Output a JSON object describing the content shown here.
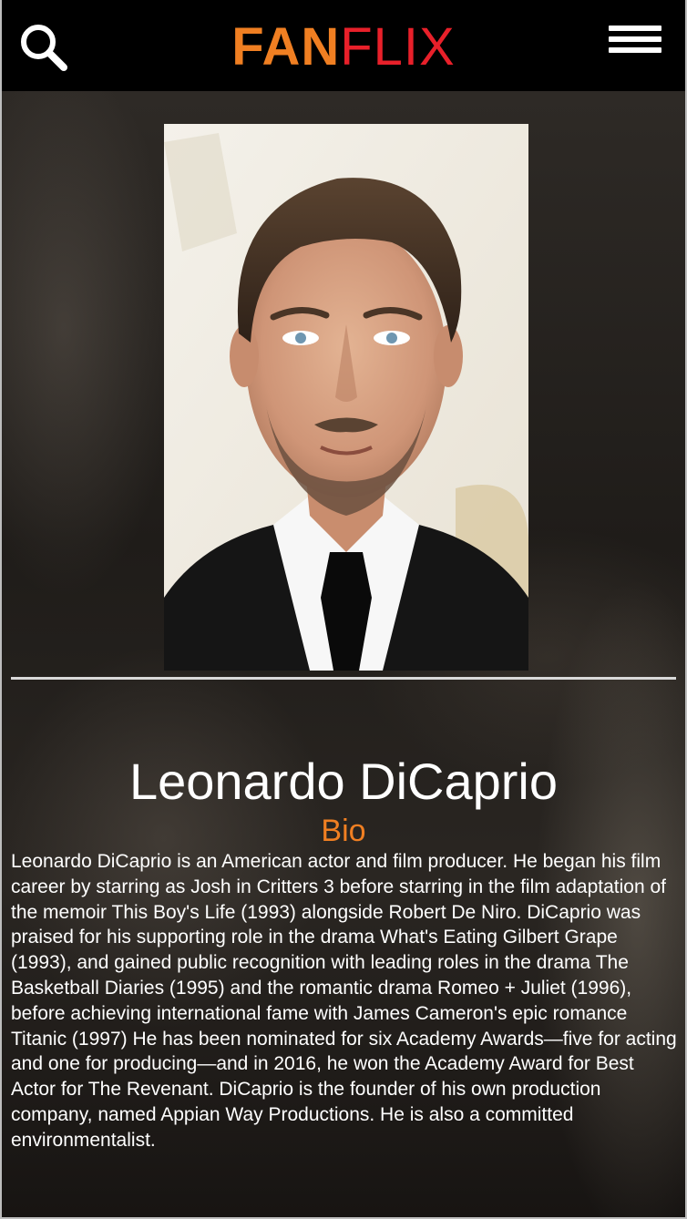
{
  "header": {
    "logo_fan": "FAN",
    "logo_flix": "FLIX",
    "search_icon": "search-icon",
    "menu_icon": "hamburger-menu-icon",
    "colors": {
      "background": "#000000",
      "fan": "#f07f22",
      "flix": "#e8202a"
    }
  },
  "profile": {
    "name": "Leonardo DiCaprio",
    "bio_heading": "Bio",
    "bio_text": "Leonardo DiCaprio is an American actor and film producer. He began his film career by starring as Josh in Critters 3 before starring in the film adaptation of the memoir This Boy's Life (1993) alongside Robert De Niro. DiCaprio was praised for his supporting role in the drama What's Eating Gilbert Grape (1993), and gained public recognition with leading roles in the drama The Basketball Diaries (1995) and the romantic drama Romeo + Juliet (1996), before achieving international fame with James Cameron's epic romance Titanic (1997) He has been nominated for six Academy Awards—five for acting and one for producing—and in 2016, he won the Academy Award for Best Actor for The Revenant. DiCaprio is the founder of his own production company, named Appian Way Productions. He is also a committed environmentalist.",
    "accent_color": "#f07f22"
  }
}
